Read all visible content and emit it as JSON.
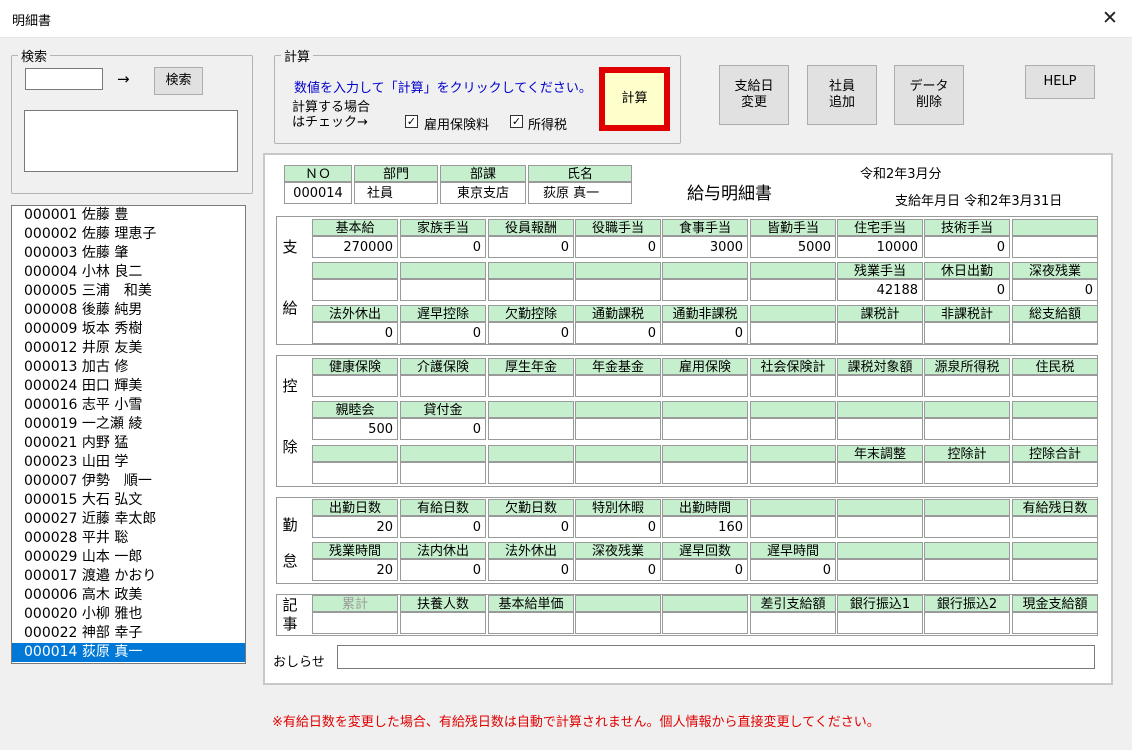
{
  "window": {
    "title": "明細書",
    "close": "✕"
  },
  "search": {
    "legend": "検索",
    "arrow": "→",
    "button": "検索",
    "value": ""
  },
  "calc": {
    "legend": "計算",
    "instruction": "数値を入力して「計算」をクリックしてください。",
    "check_label_1": "計算する場合",
    "check_label_2": "はチェック→",
    "employment_insurance": "雇用保険料",
    "income_tax": "所得税",
    "check_mark": "✓",
    "button": "計算"
  },
  "buttons": {
    "pay_date": "支給日\n変更",
    "add_employee": "社員\n追加",
    "delete_data": "データ\n削除",
    "help": "HELP"
  },
  "employees": [
    "000001 佐藤 豊",
    "000002 佐藤 理恵子",
    "000003 佐藤 肇",
    "000004 小林 良二",
    "000005 三浦　和美",
    "000008 後藤 純男",
    "000009 坂本 秀樹",
    "000012 井原 友美",
    "000013 加古 修",
    "000024 田口 輝美",
    "000016 志平 小雪",
    "000019 一之瀬 綾",
    "000021 内野 猛",
    "000023 山田 学",
    "000007 伊勢　順一",
    "000015 大石 弘文",
    "000027 近藤 幸太郎",
    "000028 平井 聡",
    "000029 山本 一郎",
    "000017 渡邉 かおり",
    "000006 高木 政美",
    "000020 小柳 雅也",
    "000022 神部 幸子",
    "000014 荻原 真一"
  ],
  "selected_index": 23,
  "slip": {
    "headers": {
      "no": "ＮＯ",
      "dept": "部門",
      "section": "部課",
      "name": "氏名"
    },
    "values": {
      "no": "000014",
      "dept": "社員",
      "section": "東京支店",
      "name": "荻原 真一"
    },
    "title": "給与明細書",
    "period": "令和2年3月分",
    "pay_date": "支給年月日 令和2年3月31日",
    "notice_label": "おしらせ",
    "notice_value": ""
  },
  "sections": {
    "payment": [
      "支",
      "給"
    ],
    "deduction": [
      "控",
      "除"
    ],
    "attendance": [
      "勤",
      "怠"
    ],
    "notes": [
      "記",
      "事"
    ]
  },
  "grid": {
    "payment_r1_h": [
      "基本給",
      "家族手当",
      "役員報酬",
      "役職手当",
      "食事手当",
      "皆勤手当",
      "住宅手当",
      "技術手当",
      ""
    ],
    "payment_r1_v": [
      "270000",
      "0",
      "0",
      "0",
      "3000",
      "5000",
      "10000",
      "0",
      ""
    ],
    "payment_r2_h": [
      "",
      "",
      "",
      "",
      "",
      "",
      "残業手当",
      "休日出勤",
      "深夜残業"
    ],
    "payment_r2_v": [
      "",
      "",
      "",
      "",
      "",
      "",
      "42188",
      "0",
      "0"
    ],
    "payment_r3_h": [
      "法外休出",
      "遅早控除",
      "欠勤控除",
      "通勤課税",
      "通勤非課税",
      "",
      "課税計",
      "非課税計",
      "総支給額"
    ],
    "payment_r3_v": [
      "0",
      "0",
      "0",
      "0",
      "0",
      "",
      "",
      "",
      ""
    ],
    "deduction_r1_h": [
      "健康保険",
      "介護保険",
      "厚生年金",
      "年金基金",
      "雇用保険",
      "社会保険計",
      "課税対象額",
      "源泉所得税",
      "住民税"
    ],
    "deduction_r1_v": [
      "",
      "",
      "",
      "",
      "",
      "",
      "",
      "",
      ""
    ],
    "deduction_r2_h": [
      "親睦会",
      "貸付金",
      "",
      "",
      "",
      "",
      "",
      "",
      ""
    ],
    "deduction_r2_v": [
      "500",
      "0",
      "",
      "",
      "",
      "",
      "",
      "",
      ""
    ],
    "deduction_r3_h": [
      "",
      "",
      "",
      "",
      "",
      "",
      "年末調整",
      "控除計",
      "控除合計"
    ],
    "deduction_r3_v": [
      "",
      "",
      "",
      "",
      "",
      "",
      "",
      "",
      ""
    ],
    "attendance_r1_h": [
      "出勤日数",
      "有給日数",
      "欠勤日数",
      "特別休暇",
      "出勤時間",
      "",
      "",
      "",
      "有給残日数"
    ],
    "attendance_r1_v": [
      "20",
      "0",
      "0",
      "0",
      "160",
      "",
      "",
      "",
      ""
    ],
    "attendance_r2_h": [
      "残業時間",
      "法内休出",
      "法外休出",
      "深夜残業",
      "遅早回数",
      "遅早時間",
      "",
      "",
      ""
    ],
    "attendance_r2_v": [
      "20",
      "0",
      "0",
      "0",
      "0",
      "0",
      "",
      "",
      ""
    ],
    "notes_r1_h": [
      "累計",
      "扶養人数",
      "基本給単価",
      "",
      "",
      "差引支給額",
      "銀行振込1",
      "銀行振込2",
      "現金支給額"
    ],
    "notes_r1_v": [
      "",
      "",
      "",
      "",
      "",
      "",
      "",
      "",
      ""
    ]
  },
  "footnote": "※有給日数を変更した場合、有給残日数は自動で計算されません。個人情報から直接変更してください。",
  "colors": {
    "header_bg": "#c6efce",
    "selection": "#0078d7",
    "calc_border": "#e00000",
    "calc_bg": "#ffffcc",
    "note": "#e00000"
  }
}
